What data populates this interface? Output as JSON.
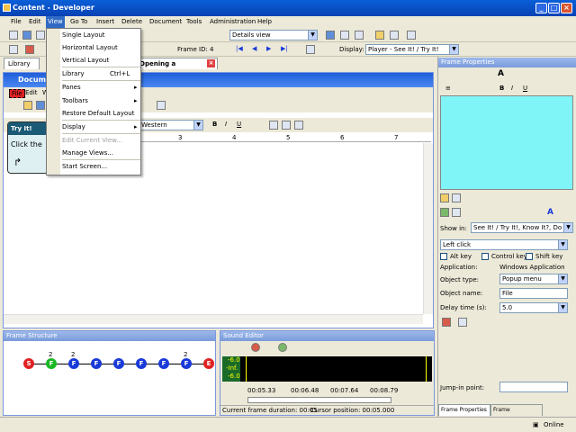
{
  "window": {
    "title": "Content - Developer"
  },
  "menubar": [
    "File",
    "Edit",
    "View",
    "Go To",
    "Insert",
    "Delete",
    "Document",
    "Tools",
    "Administration",
    "Help"
  ],
  "toolbar": {
    "frame_id_label": "Frame ID:",
    "frame_id_value": "4",
    "view_select": "Details view",
    "display_label": "Display:",
    "display_value": "Player - See It! / Try It!"
  },
  "tabs": {
    "library": "Library",
    "document": "Opening a Document"
  },
  "doc": {
    "title": "Documen",
    "menu_file": "File",
    "menu_edit": "Edit",
    "menu_w": "W",
    "font": "Western",
    "ruler_marks": [
      "3",
      "4",
      "5",
      "6",
      "7"
    ]
  },
  "tryit": {
    "heading": "Try It!",
    "body": "Click the"
  },
  "view_menu": {
    "items": [
      {
        "label": "Single Layout"
      },
      {
        "label": "Horizontal Layout"
      },
      {
        "label": "Vertical Layout"
      },
      {
        "label": "Library",
        "shortcut": "Ctrl+L"
      },
      {
        "label": "Panes",
        "arrow": "▸"
      },
      {
        "label": "Toolbars",
        "arrow": "▸"
      },
      {
        "label": "Restore Default Layout"
      },
      {
        "label": "Display",
        "arrow": "▸"
      },
      {
        "label": "Edit Current View..."
      },
      {
        "label": "Manage Views..."
      },
      {
        "label": "Start Screen..."
      }
    ]
  },
  "frame_properties": {
    "title": "Frame Properties",
    "show_in_label": "Show in:",
    "show_in_value": "See It! / Try It!, Know It?, Do It!",
    "action_value": "Left click",
    "alt_key": "Alt key",
    "control_key": "Control key",
    "shift_key": "Shift key",
    "application_label": "Application:",
    "application_value": "Windows Application",
    "object_type_label": "Object type:",
    "object_type_value": "Popup menu",
    "object_name_label": "Object name:",
    "object_name_value": "File",
    "delay_label": "Delay time (s):",
    "delay_value": "5.0",
    "jump_label": "Jump-in point:",
    "tab_properties": "Frame Properties",
    "tab_comments": "Frame Comments"
  },
  "frame_structure": {
    "title": "Frame Structure",
    "nodes": [
      "S",
      "F",
      "F",
      "F",
      "F",
      "F",
      "F",
      "F",
      "E"
    ],
    "labels": {
      "n1": "2",
      "n2": "2",
      "n7": "2"
    }
  },
  "sound_editor": {
    "title": "Sound Editor",
    "levels": [
      "-6.0",
      "-Inf.",
      "-6.0"
    ],
    "times": [
      "00:05.33",
      "00:06.48",
      "00:07.64",
      "00:08.79"
    ],
    "frame_duration": "Current frame duration: 00:05",
    "cursor_position": "Cursor position: 00:05.000"
  },
  "status": {
    "online": "Online"
  },
  "colors": {
    "title_blue": "#0842b4",
    "preview": "#80f5f8",
    "node_red": "#e02222",
    "node_green": "#19b824",
    "node_blue": "#1a3ad8"
  }
}
